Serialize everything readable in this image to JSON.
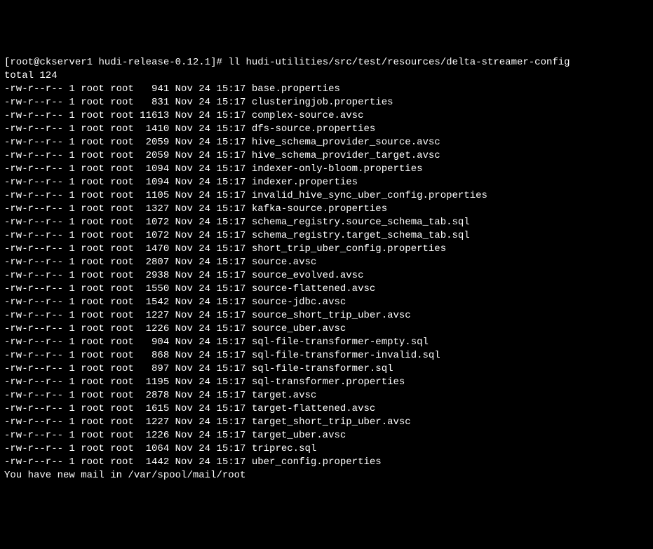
{
  "prompt": {
    "open": "[",
    "user_host": "root@ckserver1",
    "space": " ",
    "cwd": "hudi-release-0.12.1",
    "close": "]# ",
    "command": "ll hudi-utilities/src/test/resources/delta-streamer-config"
  },
  "total_line": "total 124",
  "columns_meta": "perm links owner group size month day time name",
  "files": [
    {
      "perm": "-rw-r--r--",
      "links": "1",
      "owner": "root",
      "group": "root",
      "size": "941",
      "month": "Nov",
      "day": "24",
      "time": "15:17",
      "name": "base.properties"
    },
    {
      "perm": "-rw-r--r--",
      "links": "1",
      "owner": "root",
      "group": "root",
      "size": "831",
      "month": "Nov",
      "day": "24",
      "time": "15:17",
      "name": "clusteringjob.properties"
    },
    {
      "perm": "-rw-r--r--",
      "links": "1",
      "owner": "root",
      "group": "root",
      "size": "11613",
      "month": "Nov",
      "day": "24",
      "time": "15:17",
      "name": "complex-source.avsc"
    },
    {
      "perm": "-rw-r--r--",
      "links": "1",
      "owner": "root",
      "group": "root",
      "size": "1410",
      "month": "Nov",
      "day": "24",
      "time": "15:17",
      "name": "dfs-source.properties"
    },
    {
      "perm": "-rw-r--r--",
      "links": "1",
      "owner": "root",
      "group": "root",
      "size": "2059",
      "month": "Nov",
      "day": "24",
      "time": "15:17",
      "name": "hive_schema_provider_source.avsc"
    },
    {
      "perm": "-rw-r--r--",
      "links": "1",
      "owner": "root",
      "group": "root",
      "size": "2059",
      "month": "Nov",
      "day": "24",
      "time": "15:17",
      "name": "hive_schema_provider_target.avsc"
    },
    {
      "perm": "-rw-r--r--",
      "links": "1",
      "owner": "root",
      "group": "root",
      "size": "1094",
      "month": "Nov",
      "day": "24",
      "time": "15:17",
      "name": "indexer-only-bloom.properties"
    },
    {
      "perm": "-rw-r--r--",
      "links": "1",
      "owner": "root",
      "group": "root",
      "size": "1094",
      "month": "Nov",
      "day": "24",
      "time": "15:17",
      "name": "indexer.properties"
    },
    {
      "perm": "-rw-r--r--",
      "links": "1",
      "owner": "root",
      "group": "root",
      "size": "1105",
      "month": "Nov",
      "day": "24",
      "time": "15:17",
      "name": "invalid_hive_sync_uber_config.properties"
    },
    {
      "perm": "-rw-r--r--",
      "links": "1",
      "owner": "root",
      "group": "root",
      "size": "1327",
      "month": "Nov",
      "day": "24",
      "time": "15:17",
      "name": "kafka-source.properties"
    },
    {
      "perm": "-rw-r--r--",
      "links": "1",
      "owner": "root",
      "group": "root",
      "size": "1072",
      "month": "Nov",
      "day": "24",
      "time": "15:17",
      "name": "schema_registry.source_schema_tab.sql"
    },
    {
      "perm": "-rw-r--r--",
      "links": "1",
      "owner": "root",
      "group": "root",
      "size": "1072",
      "month": "Nov",
      "day": "24",
      "time": "15:17",
      "name": "schema_registry.target_schema_tab.sql"
    },
    {
      "perm": "-rw-r--r--",
      "links": "1",
      "owner": "root",
      "group": "root",
      "size": "1470",
      "month": "Nov",
      "day": "24",
      "time": "15:17",
      "name": "short_trip_uber_config.properties"
    },
    {
      "perm": "-rw-r--r--",
      "links": "1",
      "owner": "root",
      "group": "root",
      "size": "2807",
      "month": "Nov",
      "day": "24",
      "time": "15:17",
      "name": "source.avsc"
    },
    {
      "perm": "-rw-r--r--",
      "links": "1",
      "owner": "root",
      "group": "root",
      "size": "2938",
      "month": "Nov",
      "day": "24",
      "time": "15:17",
      "name": "source_evolved.avsc"
    },
    {
      "perm": "-rw-r--r--",
      "links": "1",
      "owner": "root",
      "group": "root",
      "size": "1550",
      "month": "Nov",
      "day": "24",
      "time": "15:17",
      "name": "source-flattened.avsc"
    },
    {
      "perm": "-rw-r--r--",
      "links": "1",
      "owner": "root",
      "group": "root",
      "size": "1542",
      "month": "Nov",
      "day": "24",
      "time": "15:17",
      "name": "source-jdbc.avsc"
    },
    {
      "perm": "-rw-r--r--",
      "links": "1",
      "owner": "root",
      "group": "root",
      "size": "1227",
      "month": "Nov",
      "day": "24",
      "time": "15:17",
      "name": "source_short_trip_uber.avsc"
    },
    {
      "perm": "-rw-r--r--",
      "links": "1",
      "owner": "root",
      "group": "root",
      "size": "1226",
      "month": "Nov",
      "day": "24",
      "time": "15:17",
      "name": "source_uber.avsc"
    },
    {
      "perm": "-rw-r--r--",
      "links": "1",
      "owner": "root",
      "group": "root",
      "size": "904",
      "month": "Nov",
      "day": "24",
      "time": "15:17",
      "name": "sql-file-transformer-empty.sql"
    },
    {
      "perm": "-rw-r--r--",
      "links": "1",
      "owner": "root",
      "group": "root",
      "size": "868",
      "month": "Nov",
      "day": "24",
      "time": "15:17",
      "name": "sql-file-transformer-invalid.sql"
    },
    {
      "perm": "-rw-r--r--",
      "links": "1",
      "owner": "root",
      "group": "root",
      "size": "897",
      "month": "Nov",
      "day": "24",
      "time": "15:17",
      "name": "sql-file-transformer.sql"
    },
    {
      "perm": "-rw-r--r--",
      "links": "1",
      "owner": "root",
      "group": "root",
      "size": "1195",
      "month": "Nov",
      "day": "24",
      "time": "15:17",
      "name": "sql-transformer.properties"
    },
    {
      "perm": "-rw-r--r--",
      "links": "1",
      "owner": "root",
      "group": "root",
      "size": "2878",
      "month": "Nov",
      "day": "24",
      "time": "15:17",
      "name": "target.avsc"
    },
    {
      "perm": "-rw-r--r--",
      "links": "1",
      "owner": "root",
      "group": "root",
      "size": "1615",
      "month": "Nov",
      "day": "24",
      "time": "15:17",
      "name": "target-flattened.avsc"
    },
    {
      "perm": "-rw-r--r--",
      "links": "1",
      "owner": "root",
      "group": "root",
      "size": "1227",
      "month": "Nov",
      "day": "24",
      "time": "15:17",
      "name": "target_short_trip_uber.avsc"
    },
    {
      "perm": "-rw-r--r--",
      "links": "1",
      "owner": "root",
      "group": "root",
      "size": "1226",
      "month": "Nov",
      "day": "24",
      "time": "15:17",
      "name": "target_uber.avsc"
    },
    {
      "perm": "-rw-r--r--",
      "links": "1",
      "owner": "root",
      "group": "root",
      "size": "1064",
      "month": "Nov",
      "day": "24",
      "time": "15:17",
      "name": "triprec.sql"
    },
    {
      "perm": "-rw-r--r--",
      "links": "1",
      "owner": "root",
      "group": "root",
      "size": "1442",
      "month": "Nov",
      "day": "24",
      "time": "15:17",
      "name": "uber_config.properties"
    }
  ],
  "footer": "You have new mail in /var/spool/mail/root"
}
